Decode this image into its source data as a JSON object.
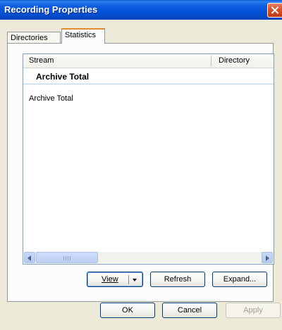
{
  "window": {
    "title": "Recording Properties"
  },
  "tabs": [
    {
      "label": "Directories"
    },
    {
      "label": "Statistics"
    }
  ],
  "listview": {
    "columns": [
      "Stream",
      "Directory"
    ],
    "group_header": "Archive Total",
    "items": [
      "Archive Total"
    ]
  },
  "actions": {
    "view": "View",
    "refresh": "Refresh",
    "expand": "Expand..."
  },
  "dialog_buttons": {
    "ok": "OK",
    "cancel": "Cancel",
    "apply": "Apply"
  },
  "colors": {
    "titlebar": "#0453d6",
    "close": "#d9542e",
    "tab_accent": "#e68b2c",
    "dialog_bg": "#ece9d8"
  },
  "icons": [
    "close-icon",
    "scroll-left-icon",
    "scroll-right-icon",
    "dropdown-caret-icon"
  ]
}
